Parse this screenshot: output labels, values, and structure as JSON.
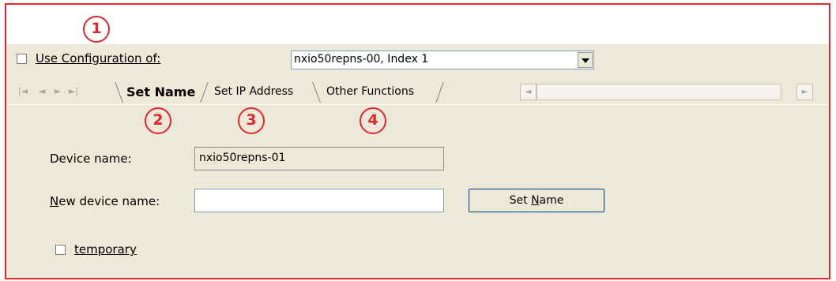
{
  "callouts": [
    "1",
    "2",
    "3",
    "4"
  ],
  "use_config": {
    "checkbox_checked": false,
    "label": "Use Configuration of:",
    "selected": "nxio50repns-00, Index 1"
  },
  "tabs": [
    {
      "label": "Set Name",
      "active": true
    },
    {
      "label": "Set IP Address",
      "active": false
    },
    {
      "label": "Other Functions",
      "active": false
    }
  ],
  "form": {
    "device_name_label": "Device name:",
    "device_name_value": "nxio50repns-01",
    "new_device_name_label": "New device name:",
    "new_device_name_value": "",
    "set_name_button": "Set Name",
    "temporary_label": "temporary",
    "temporary_checked": false
  },
  "colors": {
    "callout": "#e2262c",
    "frame_border": "#e8262d",
    "panel_bg": "#ece9d8"
  }
}
